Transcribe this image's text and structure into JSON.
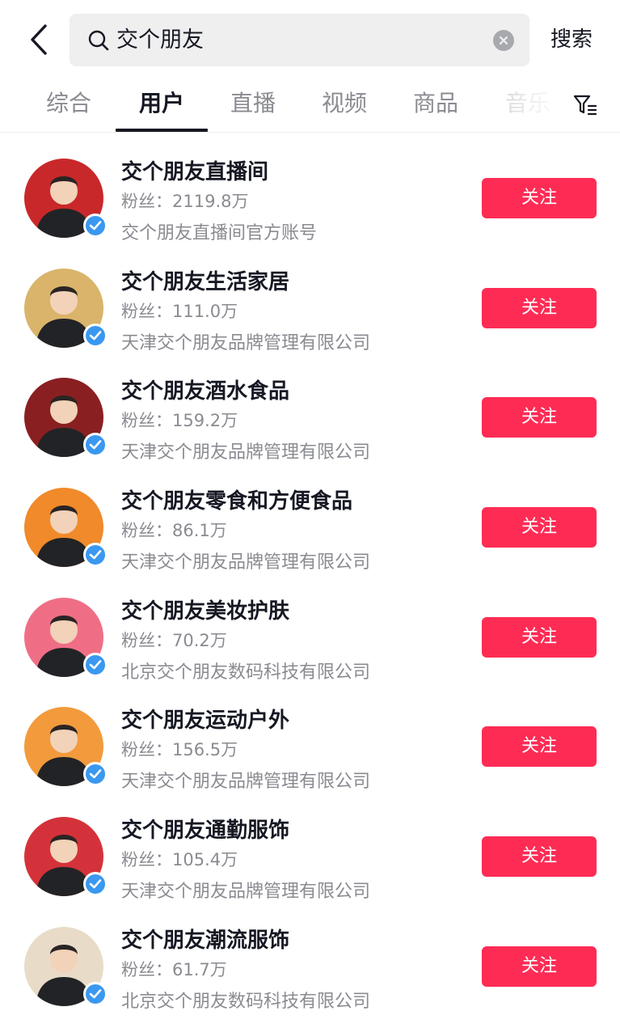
{
  "search": {
    "query": "交个朋友",
    "submit_label": "搜索"
  },
  "tabs": [
    {
      "label": "综合",
      "active": false
    },
    {
      "label": "用户",
      "active": true
    },
    {
      "label": "直播",
      "active": false
    },
    {
      "label": "视频",
      "active": false
    },
    {
      "label": "商品",
      "active": false
    },
    {
      "label": "音乐",
      "active": false
    }
  ],
  "colors": {
    "accent": "#fe2c55",
    "verified": "#3a98f0",
    "secondary_text": "#8a8b91"
  },
  "icons": {
    "back": "chevron-left-icon",
    "search": "search-icon",
    "clear": "clear-icon",
    "filter": "filter-icon",
    "verified": "verified-check-icon"
  },
  "users": [
    {
      "name": "交个朋友直播间",
      "fans": "粉丝：2119.8万",
      "desc": "交个朋友直播间官方账号",
      "follow_label": "关注",
      "avatar_bg": "#c9282a"
    },
    {
      "name": "交个朋友生活家居",
      "fans": "粉丝：111.0万",
      "desc": "天津交个朋友品牌管理有限公司",
      "follow_label": "关注",
      "avatar_bg": "#d9b46a"
    },
    {
      "name": "交个朋友酒水食品",
      "fans": "粉丝：159.2万",
      "desc": "天津交个朋友品牌管理有限公司",
      "follow_label": "关注",
      "avatar_bg": "#8a1f22"
    },
    {
      "name": "交个朋友零食和方便食品",
      "fans": "粉丝：86.1万",
      "desc": "天津交个朋友品牌管理有限公司",
      "follow_label": "关注",
      "avatar_bg": "#f08a2a"
    },
    {
      "name": "交个朋友美妆护肤",
      "fans": "粉丝：70.2万",
      "desc": "北京交个朋友数码科技有限公司",
      "follow_label": "关注",
      "avatar_bg": "#ef6e86"
    },
    {
      "name": "交个朋友运动户外",
      "fans": "粉丝：156.5万",
      "desc": "天津交个朋友品牌管理有限公司",
      "follow_label": "关注",
      "avatar_bg": "#f29a3c"
    },
    {
      "name": "交个朋友通勤服饰",
      "fans": "粉丝：105.4万",
      "desc": "天津交个朋友品牌管理有限公司",
      "follow_label": "关注",
      "avatar_bg": "#d4323a"
    },
    {
      "name": "交个朋友潮流服饰",
      "fans": "粉丝：61.7万",
      "desc": "北京交个朋友数码科技有限公司",
      "follow_label": "关注",
      "avatar_bg": "#e8dcc8"
    }
  ]
}
